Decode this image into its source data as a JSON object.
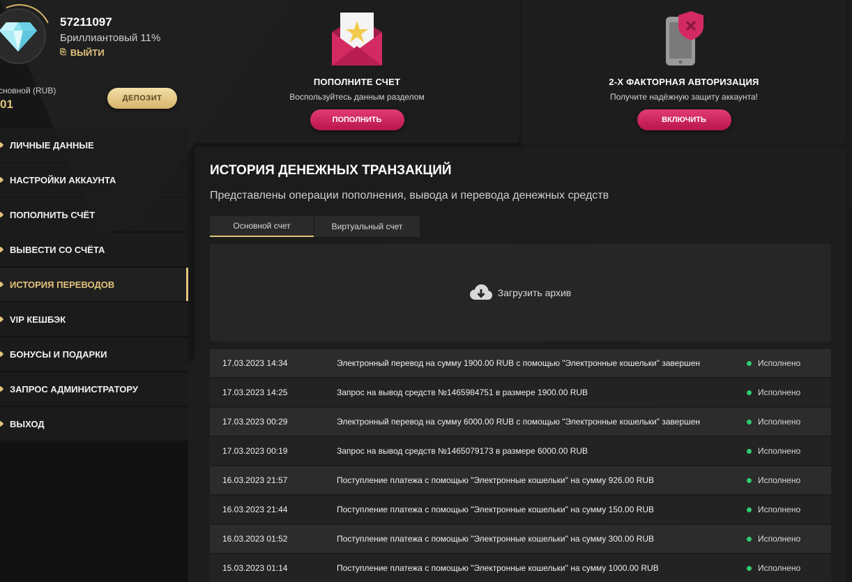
{
  "profile": {
    "user_id": "57211097",
    "level": "Бриллиантовый 11%",
    "logout_label": "ВЫЙТИ",
    "balance_label": "сновной (RUB)",
    "balance_value": "01",
    "deposit_label": "ДЕПОЗИТ"
  },
  "menu": {
    "items": [
      {
        "label": "ЛИЧНЫЕ ДАННЫЕ"
      },
      {
        "label": "НАСТРОЙКИ АККАУНТА"
      },
      {
        "label": "ПОПОЛНИТЬ СЧЁТ"
      },
      {
        "label": "ВЫВЕСТИ СО СЧЁТА"
      },
      {
        "label": "ИСТОРИЯ ПЕРЕВОДОВ"
      },
      {
        "label": "VIP КЕШБЭК"
      },
      {
        "label": "БОНУСЫ И ПОДАРКИ"
      },
      {
        "label": "ЗАПРОС АДМИНИСТРАТОРУ"
      },
      {
        "label": "ВЫХОД"
      }
    ],
    "active_index": 4
  },
  "cards": {
    "deposit": {
      "title": "ПОПОЛНИТЕ СЧЕТ",
      "subtitle": "Воспользуйтесь данным разделом",
      "button": "ПОПОЛНИТЬ",
      "icon": "envelope-star-icon"
    },
    "twofa": {
      "title": "2-Х ФАКТОРНАЯ АВТОРИЗАЦИЯ",
      "subtitle": "Получите надёжную защиту аккаунта!",
      "button": "ВКЛЮЧИТЬ",
      "icon": "phone-shield-icon"
    }
  },
  "history": {
    "title": "ИСТОРИЯ ДЕНЕЖНЫХ ТРАНЗАКЦИЙ",
    "subtitle": "Представлены операции пополнения, вывода и перевода денежных средств",
    "tabs": [
      "Основной счет",
      "Виртуальный счет"
    ],
    "archive_label": "Загрузить архив",
    "rows": [
      {
        "date": "17.03.2023 14:34",
        "desc": "Электронный перевод на сумму 1900.00 RUB с помощью \"Электронные кошельки\" завершен",
        "status": "Исполнено"
      },
      {
        "date": "17.03.2023 14:25",
        "desc": "Запрос на вывод средств №1465984751 в размере 1900.00 RUB",
        "status": "Исполнено"
      },
      {
        "date": "17.03.2023 00:29",
        "desc": "Электронный перевод на сумму 6000.00 RUB с помощью \"Электронные кошельки\" завершен",
        "status": "Исполнено"
      },
      {
        "date": "17.03.2023 00:19",
        "desc": "Запрос на вывод средств №1465079173 в размере 6000.00 RUB",
        "status": "Исполнено"
      },
      {
        "date": "16.03.2023 21:57",
        "desc": "Поступление платежа с помощью \"Электронные кошельки\" на сумму 926.00 RUB",
        "status": "Исполнено"
      },
      {
        "date": "16.03.2023 21:44",
        "desc": "Поступление платежа с помощью \"Электронные кошельки\" на сумму 150.00 RUB",
        "status": "Исполнено"
      },
      {
        "date": "16.03.2023 01:52",
        "desc": "Поступление платежа с помощью \"Электронные кошельки\" на сумму 300.00 RUB",
        "status": "Исполнено"
      },
      {
        "date": "15.03.2023 01:14",
        "desc": "Поступление платежа с помощью \"Электронные кошельки\" на сумму 1000.00 RUB",
        "status": "Исполнено"
      }
    ]
  },
  "colors": {
    "accent_gold": "#e3c47c",
    "accent_pink": "#d42a62",
    "status_green": "#2ecc71"
  }
}
